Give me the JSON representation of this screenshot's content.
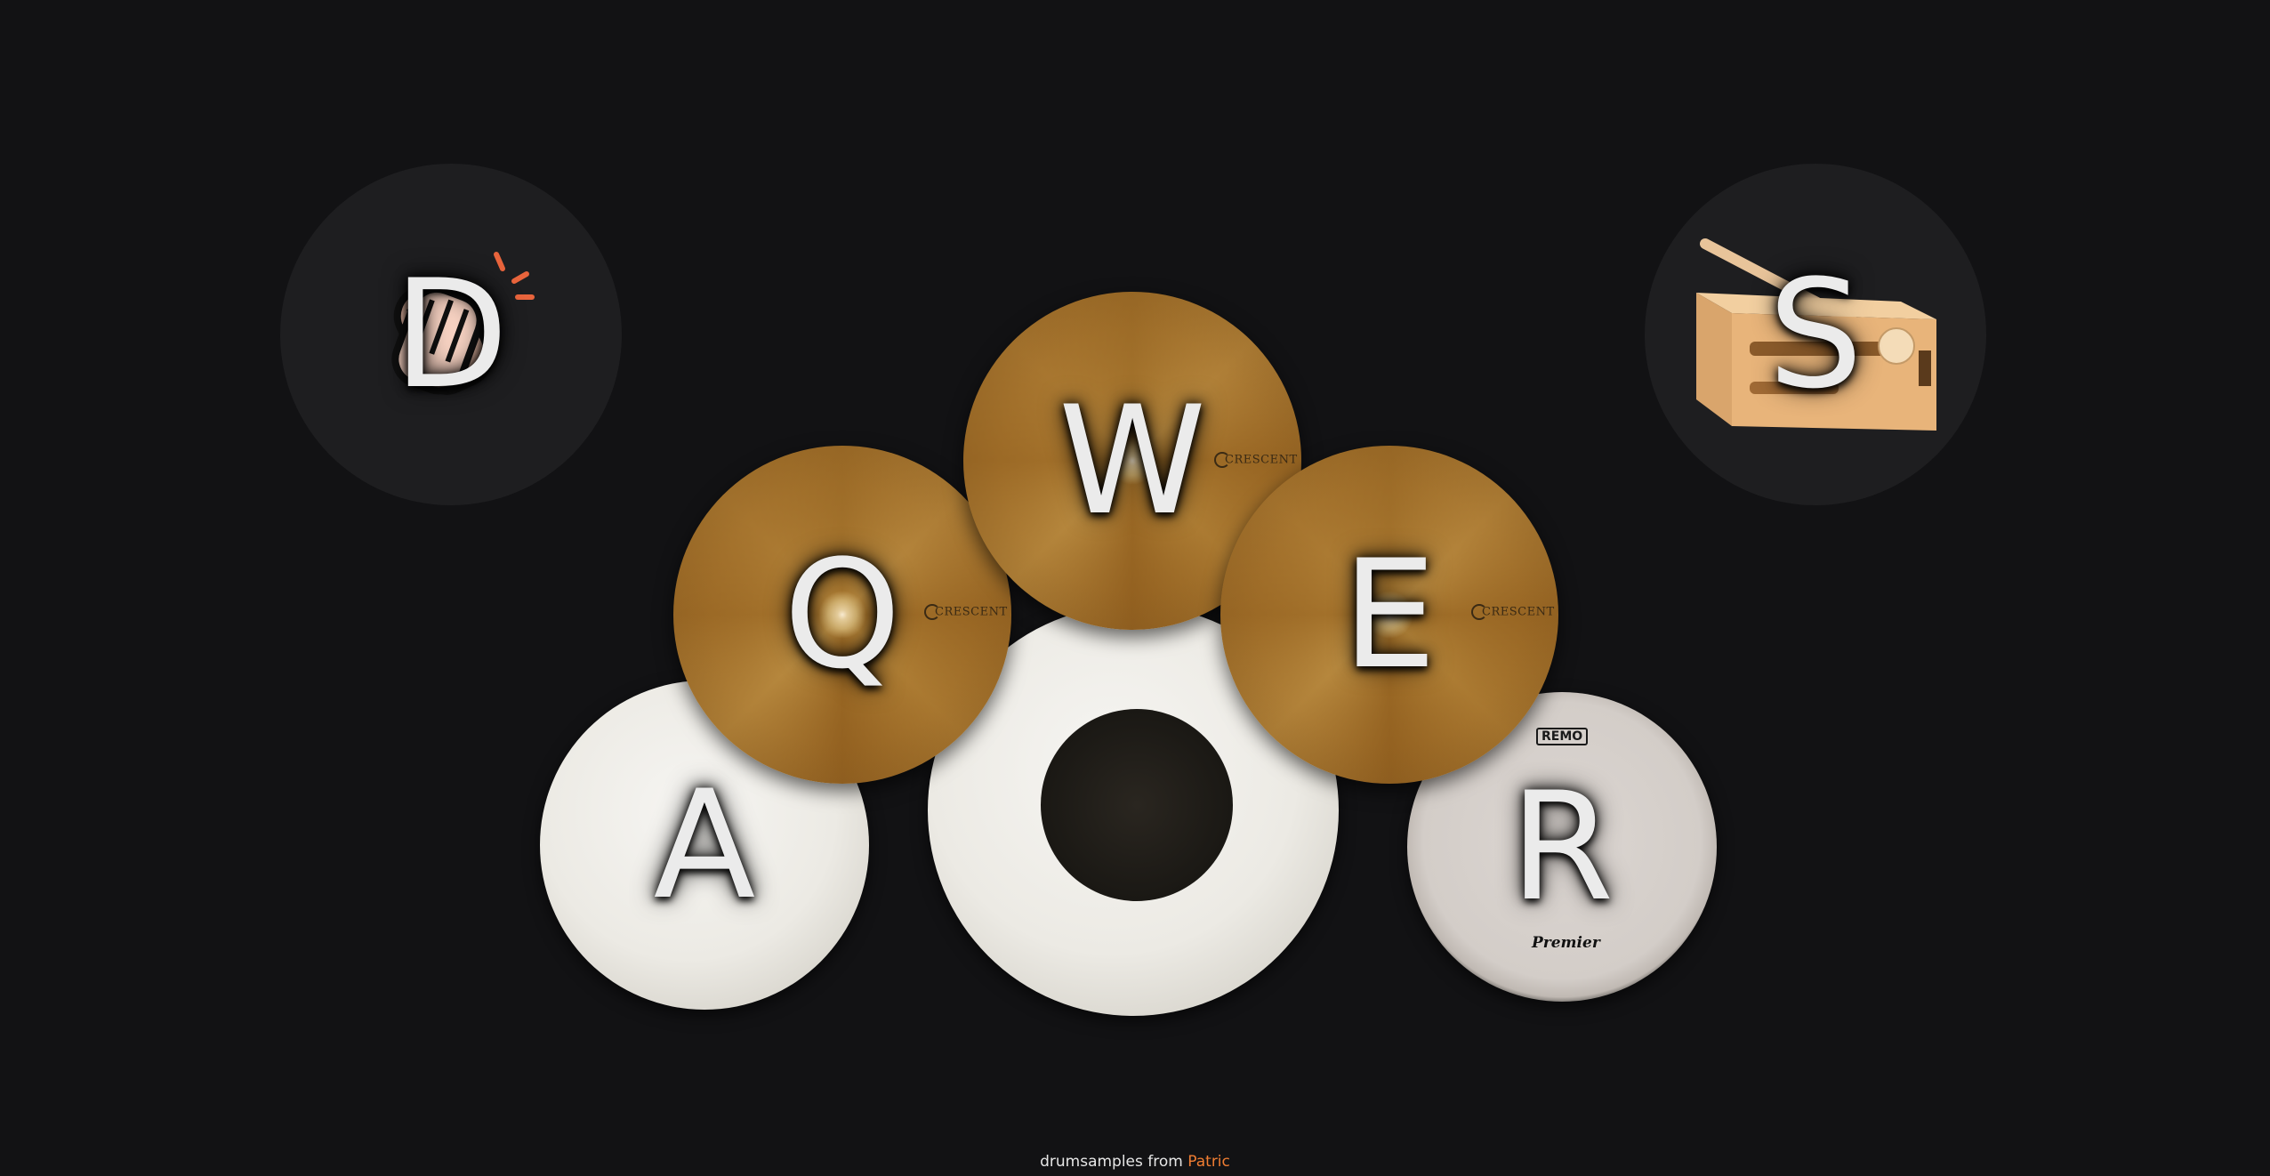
{
  "pads": {
    "clap": {
      "key": "D",
      "icon": "clapping-hands-icon"
    },
    "woodblock": {
      "key": "S",
      "icon": "woodblock-icon"
    },
    "crash_left": {
      "key": "Q",
      "brand": "CRESCENT"
    },
    "crash_center": {
      "key": "W",
      "brand": "CRESCENT"
    },
    "crash_right": {
      "key": "E",
      "brand": "CRESCENT"
    },
    "tom": {
      "key": "A"
    },
    "kick": {
      "key": ""
    },
    "snare": {
      "key": "R",
      "brand_top": "REMO",
      "brand_bottom": "Premier"
    }
  },
  "footer": {
    "text": "drumsamples from",
    "credit": "Patric"
  },
  "colors": {
    "background": "#121214",
    "pad_dark": "#1e1e20",
    "accent": "#f07d32",
    "letter": "#ebebeb"
  }
}
